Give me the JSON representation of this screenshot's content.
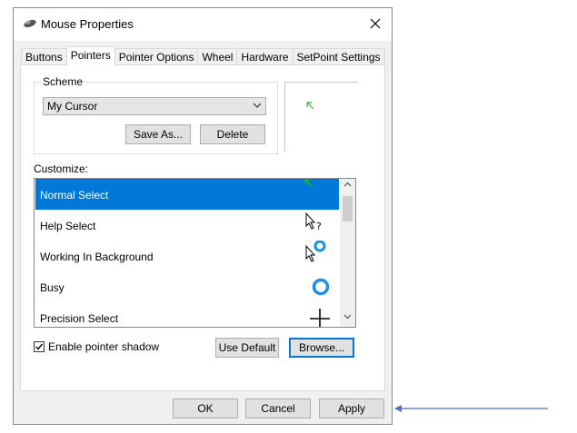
{
  "window": {
    "title": "Mouse Properties",
    "close_icon": "close-icon"
  },
  "tabs": [
    {
      "label": "Buttons"
    },
    {
      "label": "Pointers",
      "active": true
    },
    {
      "label": "Pointer Options"
    },
    {
      "label": "Wheel"
    },
    {
      "label": "Hardware"
    },
    {
      "label": "SetPoint Settings"
    }
  ],
  "scheme": {
    "legend": "Scheme",
    "selected": "My Cursor",
    "save_as_label": "Save As...",
    "delete_label": "Delete"
  },
  "customize": {
    "label": "Customize:",
    "items": [
      {
        "label": "Normal Select",
        "cursor_icon": "green-arrow-cursor-icon",
        "selected": true
      },
      {
        "label": "Help Select",
        "cursor_icon": "help-cursor-icon"
      },
      {
        "label": "Working In Background",
        "cursor_icon": "working-cursor-icon"
      },
      {
        "label": "Busy",
        "cursor_icon": "busy-ring-icon"
      },
      {
        "label": "Precision Select",
        "cursor_icon": "crosshair-icon"
      }
    ]
  },
  "options": {
    "shadow_label": "Enable pointer shadow",
    "shadow_checked": true,
    "use_default_label": "Use Default",
    "browse_label": "Browse..."
  },
  "footer": {
    "ok_label": "OK",
    "cancel_label": "Cancel",
    "apply_label": "Apply"
  },
  "colors": {
    "selection": "#0078d7",
    "cursor_green": "#2bb52b",
    "busy_blue": "#1c8fe6",
    "arrow": "#4a72c4"
  }
}
